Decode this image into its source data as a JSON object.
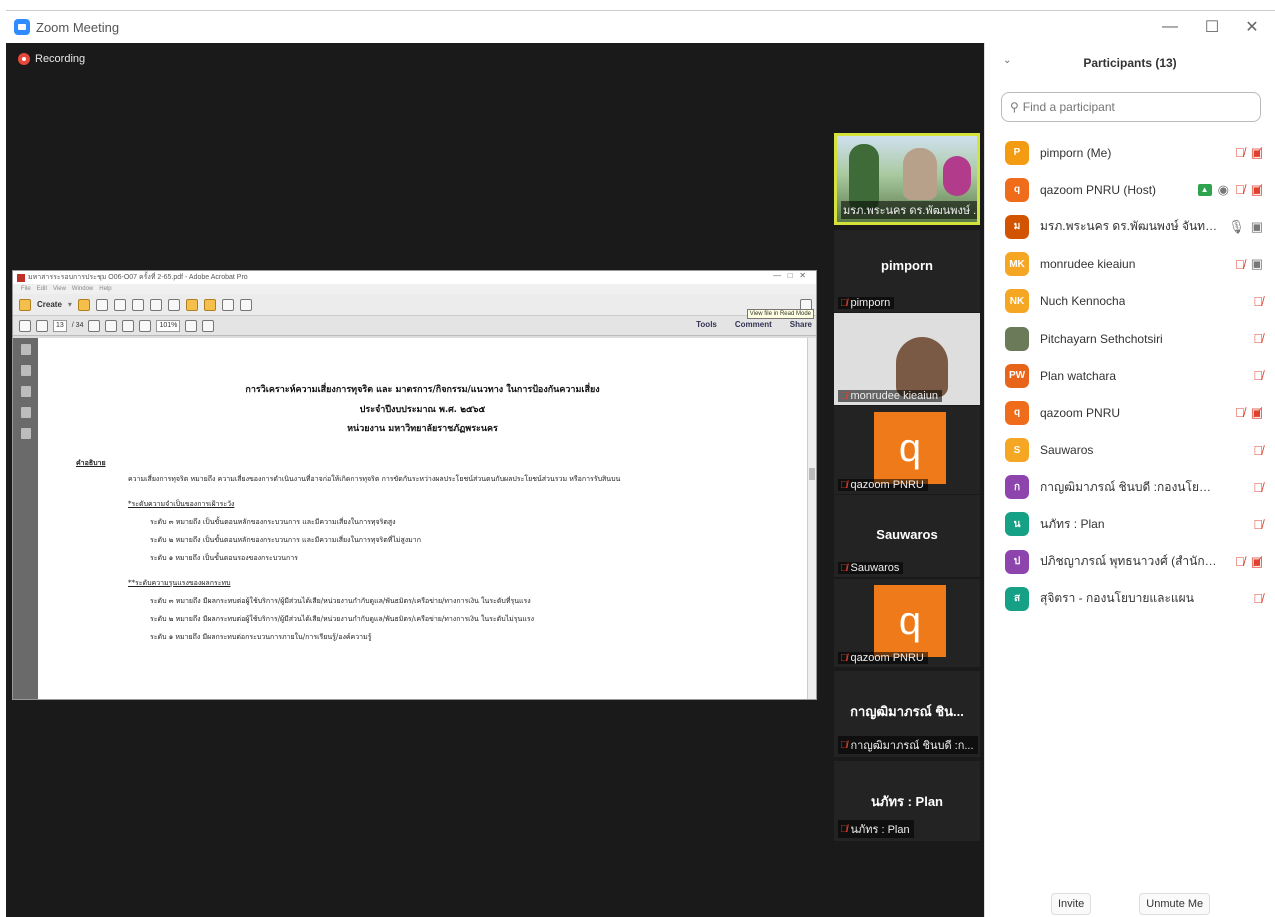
{
  "window": {
    "title": "Zoom Meeting"
  },
  "recording": {
    "label": "Recording"
  },
  "acrobat": {
    "title": "มหาสารระรอบการประชุม O06-O07 ครั้งที่ 2-65.pdf - Adobe Acrobat Pro",
    "menu": [
      "File",
      "Edit",
      "View",
      "Window",
      "Help"
    ],
    "create_label": "Create",
    "page_current": "13",
    "page_total": "/ 34",
    "zoom": "101%",
    "tools_label": "Tools",
    "comment_label": "Comment",
    "share_label": "Share",
    "tooltip": "View file in Read Mode",
    "doc": {
      "title1": "การวิเคราะห์ความเสี่ยงการทุจริต และ มาตรการ/กิจกรรม/แนวทาง ในการป้องกันความเสี่ยง",
      "title2": "ประจำปีงบประมาณ พ.ศ. ๒๕๖๕",
      "title3": "หน่วยงาน มหาวิทยาลัยราชภัฏพระนคร",
      "section": "คำอธิบาย",
      "definition": "ความเสี่ยงการทุจริต หมายถึง ความเสี่ยงของการดำเนินงานที่อาจก่อให้เกิดการทุจริต การขัดกันระหว่างผลประโยชน์ส่วนตนกับผลประโยชน์ส่วนรวม หรือการรับสินบน",
      "level_head": "*ระดับความจำเป็นของการเฝ้าระวัง",
      "level_lines": [
        "ระดับ ๓ หมายถึง เป็นขั้นตอนหลักของกระบวนการ และมีความเสี่ยงในการทุจริตสูง",
        "ระดับ ๒ หมายถึง เป็นขั้นตอนหลักของกระบวนการ และมีความเสี่ยงในการทุจริตที่ไม่สูงมาก",
        "ระดับ ๑ หมายถึง เป็นขั้นตอนรองของกระบวนการ"
      ],
      "impact_head": "**ระดับความรุนแรงของผลกระทบ",
      "impact_lines": [
        "ระดับ ๓ หมายถึง มีผลกระทบต่อผู้ใช้บริการ/ผู้มีส่วนได้เสีย/หน่วยงานกำกับดูแล/พันธมิตร/เครือข่าย/ทางการเงิน ในระดับที่รุนแรง",
        "ระดับ ๒ หมายถึง มีผลกระทบต่อผู้ใช้บริการ/ผู้มีส่วนได้เสีย/หน่วยงานกำกับดูแล/พันธมิตร/เครือข่าย/ทางการเงิน ในระดับไม่รุนแรง",
        "ระดับ ๑ หมายถึง มีผลกระทบต่อกระบวนการภายใน/การเรียนรู้/องค์ความรู้"
      ]
    }
  },
  "tiles": {
    "video1_label": "มรภ.พระนคร ดร.พัฒนพงษ์ ...",
    "pimporn_big": "pimporn",
    "pimporn_label": "pimporn",
    "monrudee_label": "monrudee kieaiun",
    "qazoom1_letter": "q",
    "qazoom1_label": "qazoom PNRU",
    "sauwaros_big": "Sauwaros",
    "sauwaros_label": "Sauwaros",
    "qazoom2_letter": "q",
    "qazoom2_label": "qazoom PNRU",
    "kanya_big": "กาญฒิมาภรณ์ ชิน...",
    "kanya_label": "กาญฒิมาภรณ์ ชินบดี :ก...",
    "napat_big": "นภัทร : Plan",
    "napat_label": "นภัทร : Plan"
  },
  "participants": {
    "title": "Participants (13)",
    "search_placeholder": "Find a participant",
    "list": [
      {
        "initials": "P",
        "color": "#f39c12",
        "name": "pimporn (Me)"
      },
      {
        "initials": "q",
        "color": "#ef6c1a",
        "name": "qazoom PNRU (Host)"
      },
      {
        "initials": "ม",
        "color": "#d35400",
        "name": "มรภ.พระนคร ดร.พัฒนพงษ์ จันทร์ควง"
      },
      {
        "initials": "MK",
        "color": "#f5a623",
        "name": "monrudee kieaiun"
      },
      {
        "initials": "NK",
        "color": "#f5a623",
        "name": "Nuch Kennocha"
      },
      {
        "initials": "",
        "color": "#6b7b5a",
        "name": "Pitchayarn Sethchotsiri"
      },
      {
        "initials": "PW",
        "color": "#e8641b",
        "name": "Plan watchara"
      },
      {
        "initials": "q",
        "color": "#ef6c1a",
        "name": "qazoom PNRU"
      },
      {
        "initials": "S",
        "color": "#f5a623",
        "name": "Sauwaros"
      },
      {
        "initials": "ก",
        "color": "#8e44ad",
        "name": "กาญฒิมาภรณ์ ชินบดี :กองนโยบายและแผน"
      },
      {
        "initials": "น",
        "color": "#16a085",
        "name": "นภัทร : Plan"
      },
      {
        "initials": "ป",
        "color": "#8e44ad",
        "name": "ปภิชญาภรณ์ พุทธนาวงศ์ (สำนักงาน..."
      },
      {
        "initials": "ส",
        "color": "#16a085",
        "name": "สุจิตรา - กองนโยบายและแผน"
      }
    ],
    "invite_label": "Invite",
    "unmute_label": "Unmute Me"
  }
}
